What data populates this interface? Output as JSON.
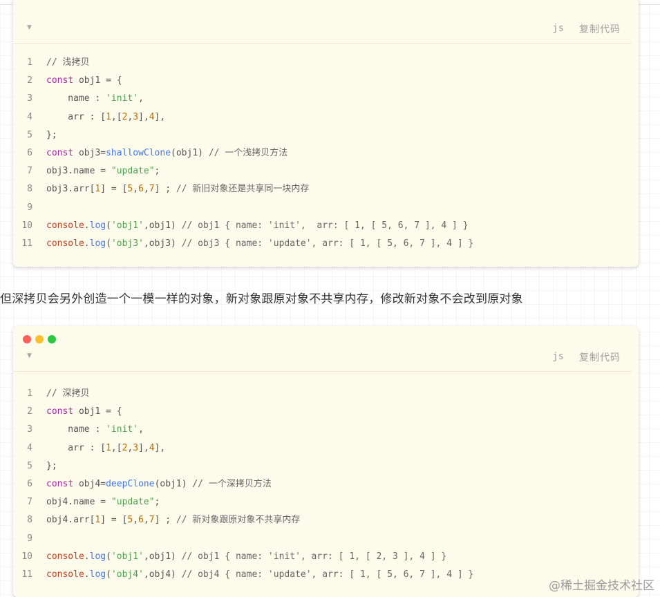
{
  "paragraph": "但深拷贝会另外创造一个一模一样的对象，新对象跟原对象不共享内存，修改新对象不会改到原对象",
  "watermark": "@稀土掘金技术社区",
  "code_blocks": [
    {
      "language": "js",
      "copy_label": "复制代码",
      "caret": "▼",
      "lines": [
        {
          "n": "1",
          "tokens": [
            {
              "t": "// 浅拷贝",
              "c": "cm"
            }
          ]
        },
        {
          "n": "2",
          "tokens": [
            {
              "t": "const",
              "c": "kw"
            },
            {
              "t": " obj1 = {",
              "c": "def"
            }
          ]
        },
        {
          "n": "3",
          "tokens": [
            {
              "t": "    name : ",
              "c": "def"
            },
            {
              "t": "'init'",
              "c": "str"
            },
            {
              "t": ",",
              "c": "def"
            }
          ]
        },
        {
          "n": "4",
          "tokens": [
            {
              "t": "    arr : [",
              "c": "def"
            },
            {
              "t": "1",
              "c": "num"
            },
            {
              "t": ",[",
              "c": "def"
            },
            {
              "t": "2",
              "c": "num"
            },
            {
              "t": ",",
              "c": "def"
            },
            {
              "t": "3",
              "c": "num"
            },
            {
              "t": "],",
              "c": "def"
            },
            {
              "t": "4",
              "c": "num"
            },
            {
              "t": "],",
              "c": "def"
            }
          ]
        },
        {
          "n": "5",
          "tokens": [
            {
              "t": "};",
              "c": "def"
            }
          ]
        },
        {
          "n": "6",
          "tokens": [
            {
              "t": "const",
              "c": "kw"
            },
            {
              "t": " obj3=",
              "c": "def"
            },
            {
              "t": "shallowClone",
              "c": "fn"
            },
            {
              "t": "(obj1) ",
              "c": "def"
            },
            {
              "t": "// 一个浅拷贝方法",
              "c": "cm"
            }
          ]
        },
        {
          "n": "7",
          "tokens": [
            {
              "t": "obj3.name = ",
              "c": "def"
            },
            {
              "t": "\"update\"",
              "c": "str"
            },
            {
              "t": ";",
              "c": "def"
            }
          ]
        },
        {
          "n": "8",
          "tokens": [
            {
              "t": "obj3.arr[",
              "c": "def"
            },
            {
              "t": "1",
              "c": "num"
            },
            {
              "t": "] = [",
              "c": "def"
            },
            {
              "t": "5",
              "c": "num"
            },
            {
              "t": ",",
              "c": "def"
            },
            {
              "t": "6",
              "c": "num"
            },
            {
              "t": ",",
              "c": "def"
            },
            {
              "t": "7",
              "c": "num"
            },
            {
              "t": "] ; ",
              "c": "def"
            },
            {
              "t": "// 新旧对象还是共享同一块内存",
              "c": "cm"
            }
          ]
        },
        {
          "n": "9",
          "tokens": [
            {
              "t": "",
              "c": "def"
            }
          ]
        },
        {
          "n": "10",
          "tokens": [
            {
              "t": "console",
              "c": "obj"
            },
            {
              "t": ".",
              "c": "def"
            },
            {
              "t": "log",
              "c": "fn"
            },
            {
              "t": "(",
              "c": "def"
            },
            {
              "t": "'obj1'",
              "c": "str"
            },
            {
              "t": ",obj1) ",
              "c": "def"
            },
            {
              "t": "// obj1 { name: 'init',  arr: [ 1, [ 5, 6, 7 ], 4 ] }",
              "c": "cm"
            }
          ]
        },
        {
          "n": "11",
          "tokens": [
            {
              "t": "console",
              "c": "obj"
            },
            {
              "t": ".",
              "c": "def"
            },
            {
              "t": "log",
              "c": "fn"
            },
            {
              "t": "(",
              "c": "def"
            },
            {
              "t": "'obj3'",
              "c": "str"
            },
            {
              "t": ",obj3) ",
              "c": "def"
            },
            {
              "t": "// obj3 { name: 'update', arr: [ 1, [ 5, 6, 7 ], 4 ] }",
              "c": "cm"
            }
          ]
        }
      ]
    },
    {
      "language": "js",
      "copy_label": "复制代码",
      "caret": "▼",
      "lines": [
        {
          "n": "1",
          "tokens": [
            {
              "t": "// 深拷贝",
              "c": "cm"
            }
          ]
        },
        {
          "n": "2",
          "tokens": [
            {
              "t": "const",
              "c": "kw"
            },
            {
              "t": " obj1 = {",
              "c": "def"
            }
          ]
        },
        {
          "n": "3",
          "tokens": [
            {
              "t": "    name : ",
              "c": "def"
            },
            {
              "t": "'init'",
              "c": "str"
            },
            {
              "t": ",",
              "c": "def"
            }
          ]
        },
        {
          "n": "4",
          "tokens": [
            {
              "t": "    arr : [",
              "c": "def"
            },
            {
              "t": "1",
              "c": "num"
            },
            {
              "t": ",[",
              "c": "def"
            },
            {
              "t": "2",
              "c": "num"
            },
            {
              "t": ",",
              "c": "def"
            },
            {
              "t": "3",
              "c": "num"
            },
            {
              "t": "],",
              "c": "def"
            },
            {
              "t": "4",
              "c": "num"
            },
            {
              "t": "],",
              "c": "def"
            }
          ]
        },
        {
          "n": "5",
          "tokens": [
            {
              "t": "};",
              "c": "def"
            }
          ]
        },
        {
          "n": "6",
          "tokens": [
            {
              "t": "const",
              "c": "kw"
            },
            {
              "t": " obj4=",
              "c": "def"
            },
            {
              "t": "deepClone",
              "c": "fn"
            },
            {
              "t": "(obj1) ",
              "c": "def"
            },
            {
              "t": "// 一个深拷贝方法",
              "c": "cm"
            }
          ]
        },
        {
          "n": "7",
          "tokens": [
            {
              "t": "obj4.name = ",
              "c": "def"
            },
            {
              "t": "\"update\"",
              "c": "str"
            },
            {
              "t": ";",
              "c": "def"
            }
          ]
        },
        {
          "n": "8",
          "tokens": [
            {
              "t": "obj4.arr[",
              "c": "def"
            },
            {
              "t": "1",
              "c": "num"
            },
            {
              "t": "] = [",
              "c": "def"
            },
            {
              "t": "5",
              "c": "num"
            },
            {
              "t": ",",
              "c": "def"
            },
            {
              "t": "6",
              "c": "num"
            },
            {
              "t": ",",
              "c": "def"
            },
            {
              "t": "7",
              "c": "num"
            },
            {
              "t": "] ; ",
              "c": "def"
            },
            {
              "t": "// 新对象跟原对象不共享内存",
              "c": "cm"
            }
          ]
        },
        {
          "n": "9",
          "tokens": [
            {
              "t": "",
              "c": "def"
            }
          ]
        },
        {
          "n": "10",
          "tokens": [
            {
              "t": "console",
              "c": "obj"
            },
            {
              "t": ".",
              "c": "def"
            },
            {
              "t": "log",
              "c": "fn"
            },
            {
              "t": "(",
              "c": "def"
            },
            {
              "t": "'obj1'",
              "c": "str"
            },
            {
              "t": ",obj1) ",
              "c": "def"
            },
            {
              "t": "// obj1 { name: 'init', arr: [ 1, [ 2, 3 ], 4 ] }",
              "c": "cm"
            }
          ]
        },
        {
          "n": "11",
          "tokens": [
            {
              "t": "console",
              "c": "obj"
            },
            {
              "t": ".",
              "c": "def"
            },
            {
              "t": "log",
              "c": "fn"
            },
            {
              "t": "(",
              "c": "def"
            },
            {
              "t": "'obj4'",
              "c": "str"
            },
            {
              "t": ",obj4) ",
              "c": "def"
            },
            {
              "t": "// obj4 { name: 'update', arr: [ 1, [ 5, 6, 7 ], 4 ] }",
              "c": "cm"
            }
          ]
        }
      ]
    }
  ]
}
